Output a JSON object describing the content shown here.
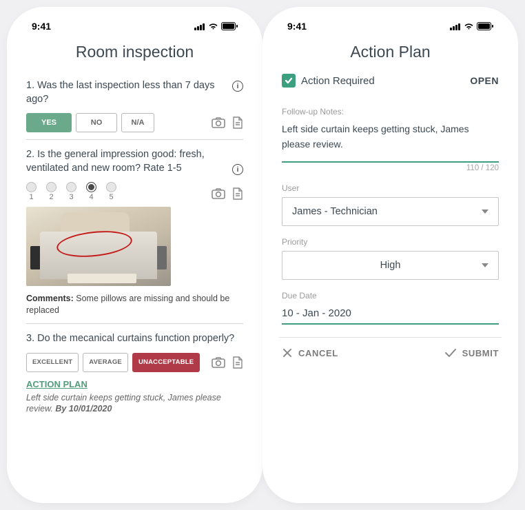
{
  "status_bar": {
    "time": "9:41"
  },
  "left": {
    "title": "Room inspection",
    "q1": {
      "text": "1. Was the last inspection less than 7 days ago?",
      "yes": "YES",
      "no": "NO",
      "na": "N/A"
    },
    "q2": {
      "text": "2. Is the general impression good: fresh, ventilated and new room? Rate 1-5",
      "options": [
        "1",
        "2",
        "3",
        "4",
        "5"
      ],
      "selected": "4",
      "comments_label": "Comments:",
      "comments": "Some pillows are missing and should be replaced"
    },
    "q3": {
      "text": "3. Do the mecanical curtains function properly?",
      "excellent": "EXCELLENT",
      "average": "AVERAGE",
      "unacceptable": "UNACCEPTABLE"
    },
    "action": {
      "link": "ACTION PLAN",
      "note_pre": "Left side curtain keeps getting stuck, James please review. ",
      "note_date": "By 10/01/2020"
    }
  },
  "right": {
    "title": "Action Plan",
    "action_required": "Action Required",
    "status": "OPEN",
    "notes_label": "Follow-up Notes:",
    "notes": "Left side curtain keeps getting stuck, James please review.",
    "char_count": "110 / 120",
    "user_label": "User",
    "user_value": "James  - Technician",
    "priority_label": "Priority",
    "priority_value": "High",
    "due_label": "Due Date",
    "due_value": "10 - Jan  - 2020",
    "cancel": "CANCEL",
    "submit": "SUBMIT"
  }
}
